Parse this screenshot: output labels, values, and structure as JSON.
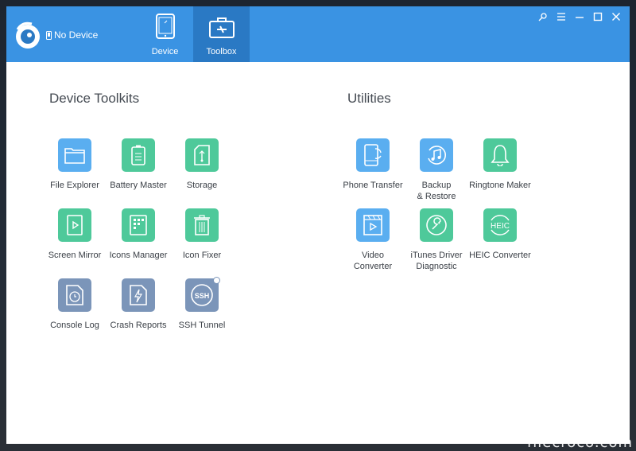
{
  "app": {
    "device_status": "No Device",
    "tabs": [
      {
        "label": "Device",
        "icon": "tablet-icon"
      },
      {
        "label": "Toolbox",
        "icon": "toolbox-icon"
      }
    ],
    "window_controls": [
      "pin-icon",
      "menu-icon",
      "minimize-icon",
      "maximize-icon",
      "close-icon"
    ]
  },
  "device_toolkits": {
    "title": "Device Toolkits",
    "items": [
      {
        "label": "File Explorer",
        "icon": "folder-icon",
        "color": "#5aaef0"
      },
      {
        "label": "Battery Master",
        "icon": "battery-icon",
        "color": "#4ec99a"
      },
      {
        "label": "Storage",
        "icon": "usb-storage-icon",
        "color": "#4ec99a"
      },
      {
        "label": "Screen Mirror",
        "icon": "play-screen-icon",
        "color": "#4ec99a"
      },
      {
        "label": "Icons Manager",
        "icon": "grid-icon",
        "color": "#4ec99a"
      },
      {
        "label": "Icon Fixer",
        "icon": "trash-icon",
        "color": "#4ec99a"
      },
      {
        "label": "Console Log",
        "icon": "clock-doc-icon",
        "color": "#7b95b9"
      },
      {
        "label": "Crash Reports",
        "icon": "lightning-doc-icon",
        "color": "#7b95b9"
      },
      {
        "label": "SSH Tunnel",
        "icon": "ssh-icon",
        "color": "#7b95b9"
      }
    ]
  },
  "utilities": {
    "title": "Utilities",
    "items": [
      {
        "label": "Phone Transfer",
        "icon": "phone-transfer-icon",
        "color": "#5aaef0"
      },
      {
        "label": "Backup\n& Restore",
        "icon": "music-restore-icon",
        "color": "#5aaef0"
      },
      {
        "label": "Ringtone Maker",
        "icon": "bell-icon",
        "color": "#4ec99a"
      },
      {
        "label": "Video\nConverter",
        "icon": "video-icon",
        "color": "#5aaef0"
      },
      {
        "label": "iTunes Driver\nDiagnostic",
        "icon": "wrench-icon",
        "color": "#4ec99a"
      },
      {
        "label": "HEIC Converter",
        "icon": "heic-icon",
        "color": "#4ec99a"
      }
    ]
  },
  "watermark": "filecroco.com"
}
